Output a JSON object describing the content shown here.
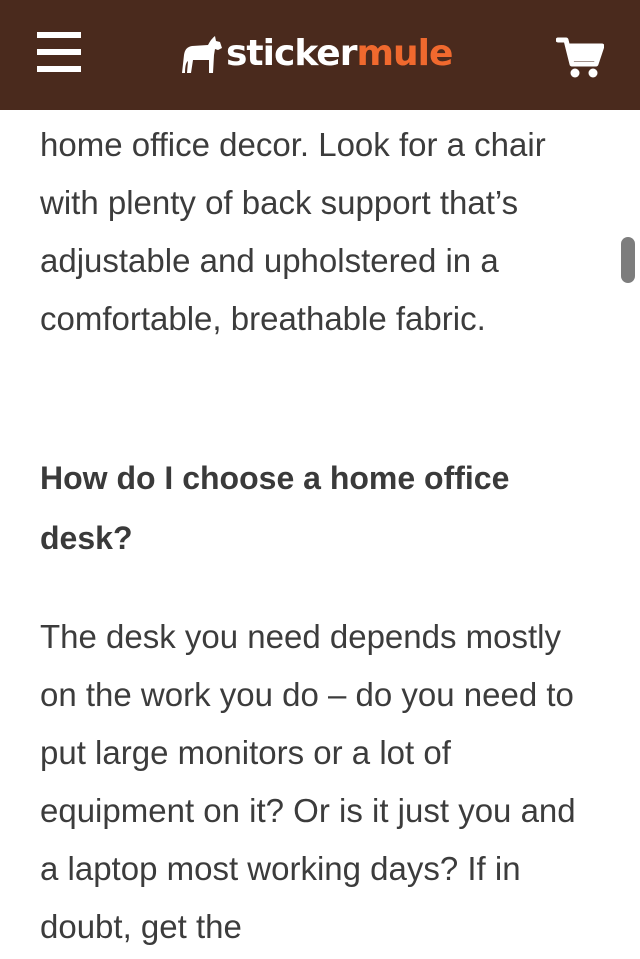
{
  "header": {
    "menu_icon": "hamburger-menu-icon",
    "logo": {
      "icon": "mule-icon",
      "text_part1": "sticker",
      "text_part2": "mule"
    },
    "cart_icon": "shopping-cart-icon",
    "colors": {
      "background": "#4a2a1d",
      "accent": "#f0692e"
    }
  },
  "article": {
    "paragraph_1": "home office decor. Look for a chair with plenty of back support that’s adjustable and upholstered in a comfortable, breathable fabric.",
    "heading_1": "How do I choose a home office desk?",
    "paragraph_2": "The desk you need depends mostly on the work you do – do you need to put large monitors or a lot of equipment on it? Or is it just you and a laptop most working days? If in doubt, get the"
  }
}
